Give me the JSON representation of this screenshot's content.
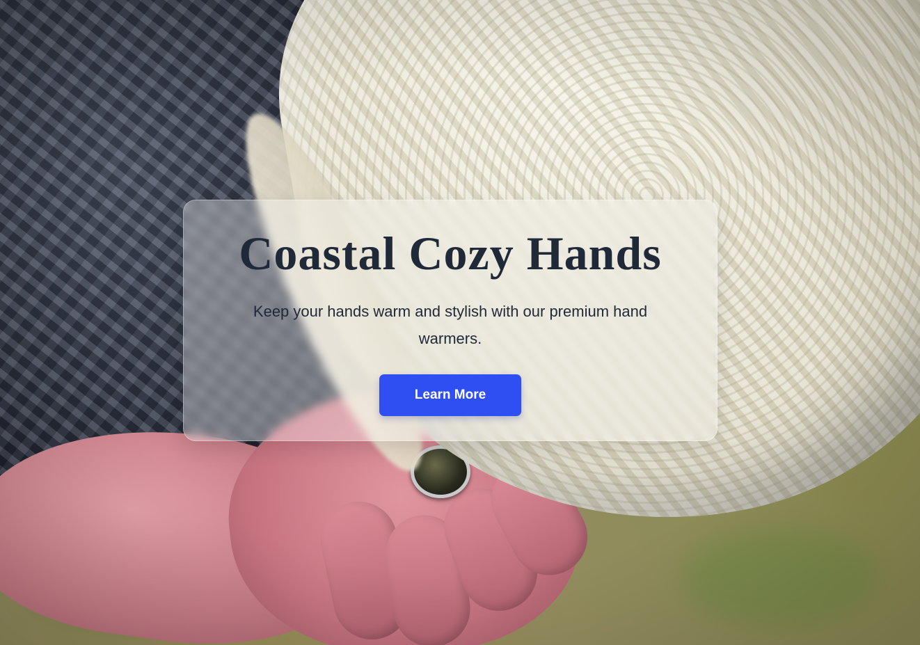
{
  "hero": {
    "title": "Coastal Cozy Hands",
    "subtitle": "Keep your hands warm and stylish with our premium hand warmers.",
    "cta_label": "Learn More"
  },
  "colors": {
    "title_text": "#1f2937",
    "cta_background": "#2f4ff2",
    "cta_text": "#ffffff",
    "card_background": "rgba(255,255,255,0.34)"
  },
  "background": {
    "image_description_icon": "knit-hand-warmers-photo"
  }
}
